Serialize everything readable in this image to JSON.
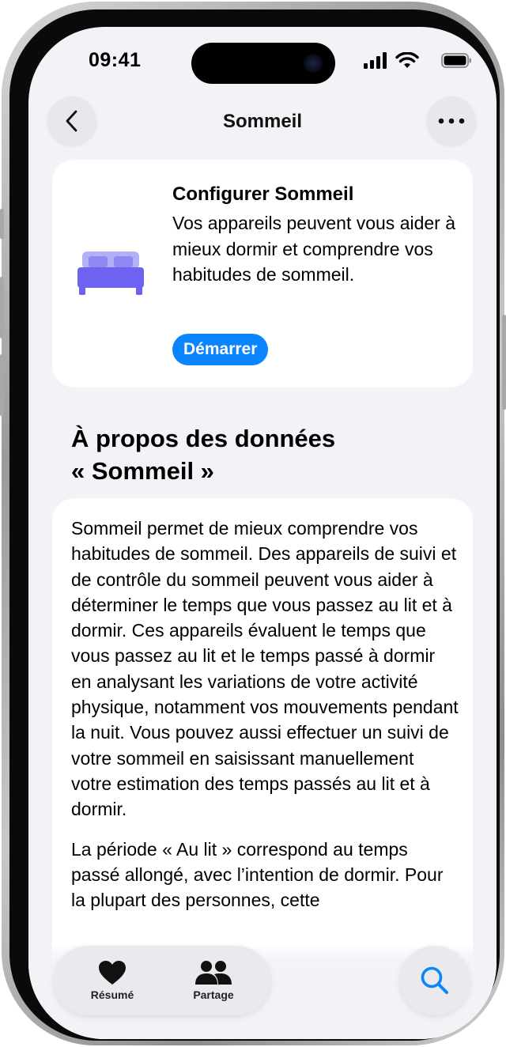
{
  "status_bar": {
    "time": "09:41"
  },
  "nav": {
    "title": "Sommeil"
  },
  "setup_card": {
    "title": "Configurer Sommeil",
    "description": "Vos appareils peuvent vous aider à mieux dormir et comprendre vos habitudes de sommeil.",
    "button_label": "Démarrer"
  },
  "about": {
    "title_line1": "À propos des données",
    "title_line2": "« Sommeil »",
    "paragraph1": "Sommeil permet de mieux comprendre vos habitudes de sommeil. Des appareils de suivi et de contrôle du sommeil peuvent vous aider à déterminer le temps que vous passez au lit et à dormir. Ces appareils évaluent le temps que vous passez au lit et le temps passé à dormir en analysant les variations de votre activité physique, notamment vos mouvements pendant la nuit. Vous pouvez aussi effectuer un suivi de votre sommeil en saisissant manuellement votre estimation des temps passés au lit et à dormir.",
    "paragraph2": "La période « Au lit » correspond au temps passé allongé, avec l’intention de dormir. Pour la plupart des personnes, cette"
  },
  "tabbar": {
    "tabs": [
      {
        "label": "Résumé",
        "icon": "heart-icon"
      },
      {
        "label": "Partage",
        "icon": "people-icon"
      }
    ]
  },
  "colors": {
    "accent": "#0a84ff",
    "bed_icon": "#6e62f0",
    "background": "#f2f2f7"
  }
}
